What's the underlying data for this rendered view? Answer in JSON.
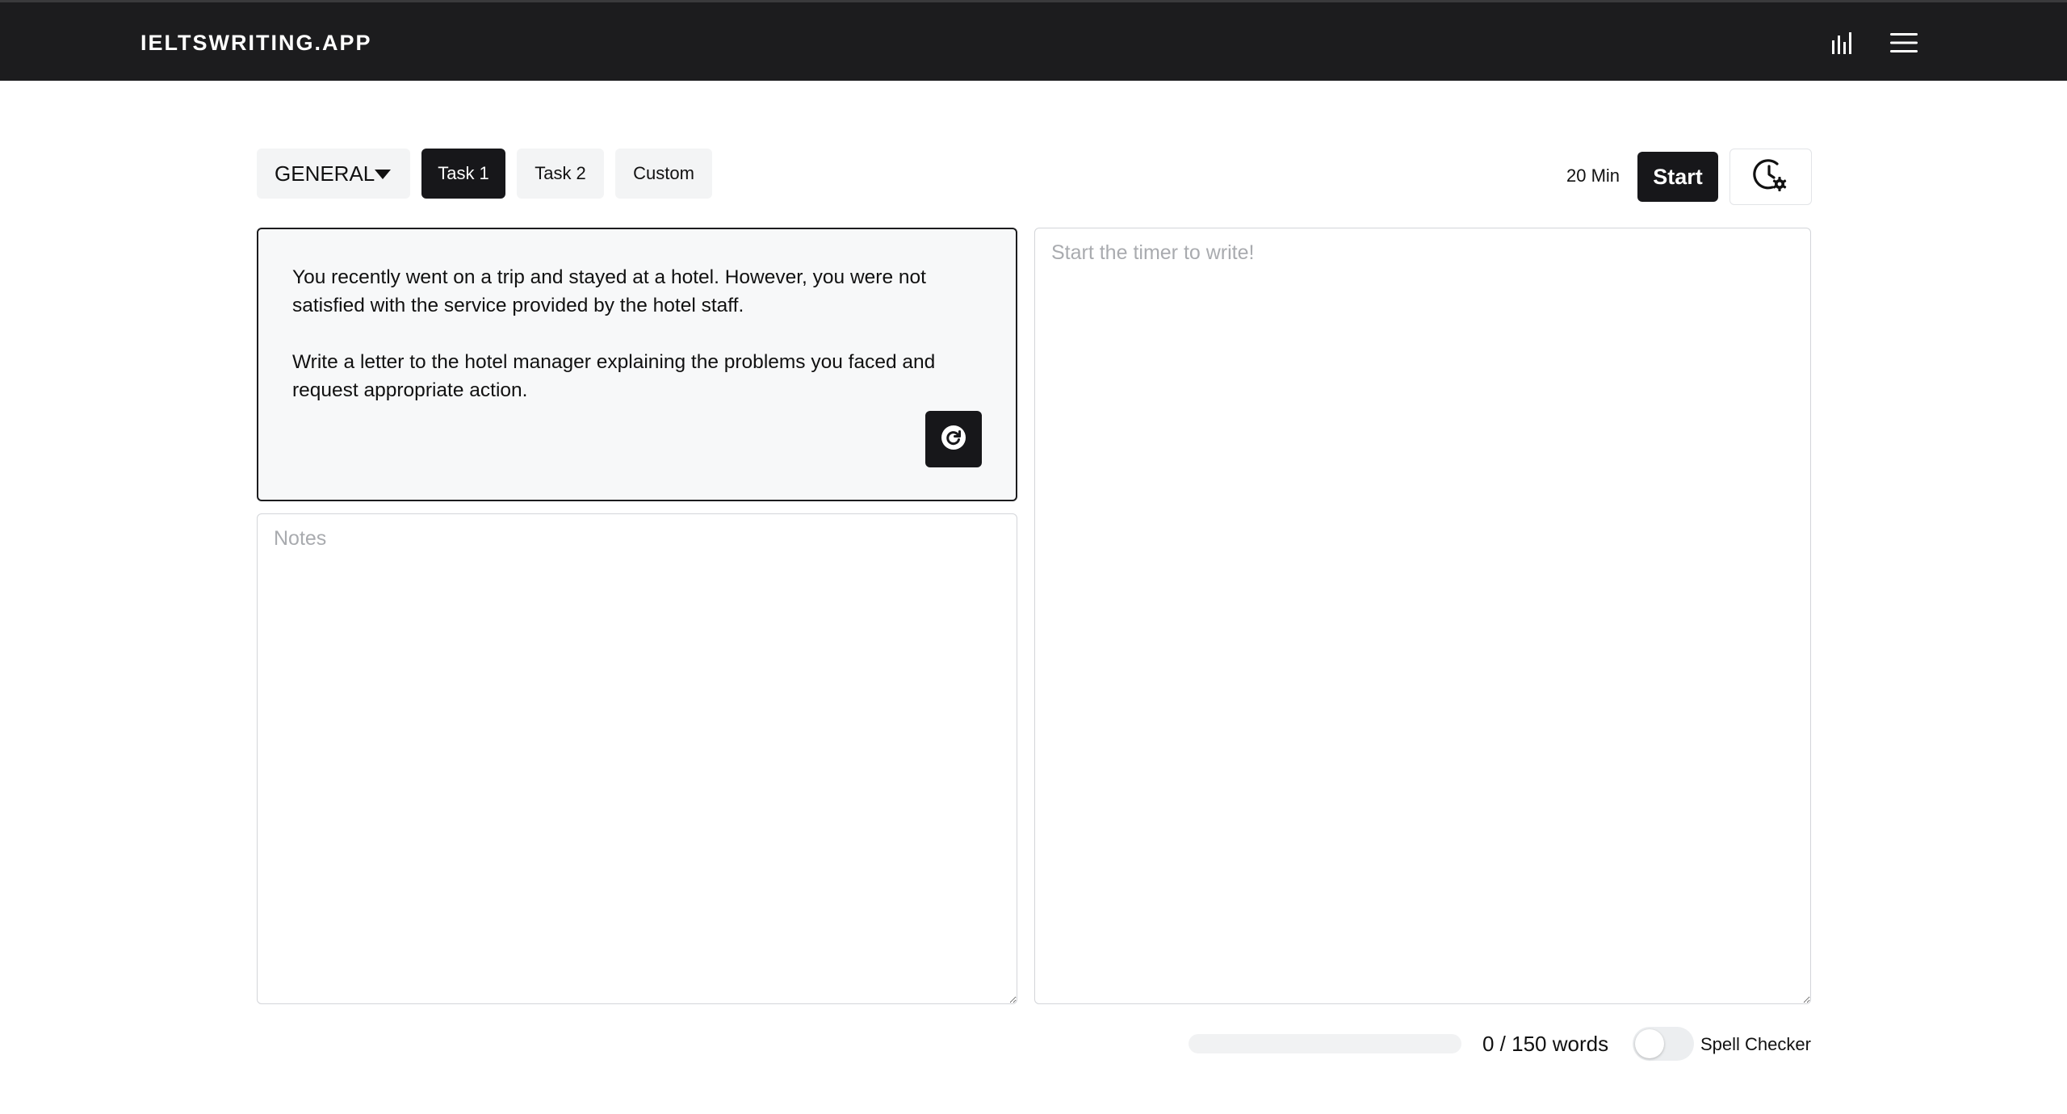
{
  "header": {
    "brand": "IELTSWRITING.APP",
    "stats_icon": "bar-chart-icon",
    "menu_icon": "hamburger-menu-icon"
  },
  "toolbar": {
    "mode_select": {
      "selected": "GENERAL",
      "icon": "caret-down-icon"
    },
    "tasks": [
      {
        "label": "Task 1",
        "active": true
      },
      {
        "label": "Task 2",
        "active": false
      },
      {
        "label": "Custom",
        "active": false
      }
    ],
    "timer_label": "20 Min",
    "start_label": "Start",
    "timer_settings_icon": "clock-gear-icon"
  },
  "prompt": {
    "paragraphs": [
      "You recently went on a trip and stayed at a hotel. However, you were not satisfied with the service provided by the hotel staff.",
      "Write a letter to the hotel manager explaining the problems you faced and request appropriate action."
    ],
    "refresh_icon": "refresh-icon"
  },
  "notes": {
    "placeholder": "Notes",
    "value": ""
  },
  "essay": {
    "placeholder": "Start the timer to write!",
    "value": ""
  },
  "footer": {
    "progress": 0,
    "word_count": "0 / 150 words",
    "spell_checker": {
      "label": "Spell Checker",
      "enabled": false
    }
  },
  "colors": {
    "navbar_bg": "#1c1c1e",
    "accent_dark": "#17171a",
    "secondary_bg": "#f3f4f5",
    "prompt_bg": "#f7f8f9"
  }
}
